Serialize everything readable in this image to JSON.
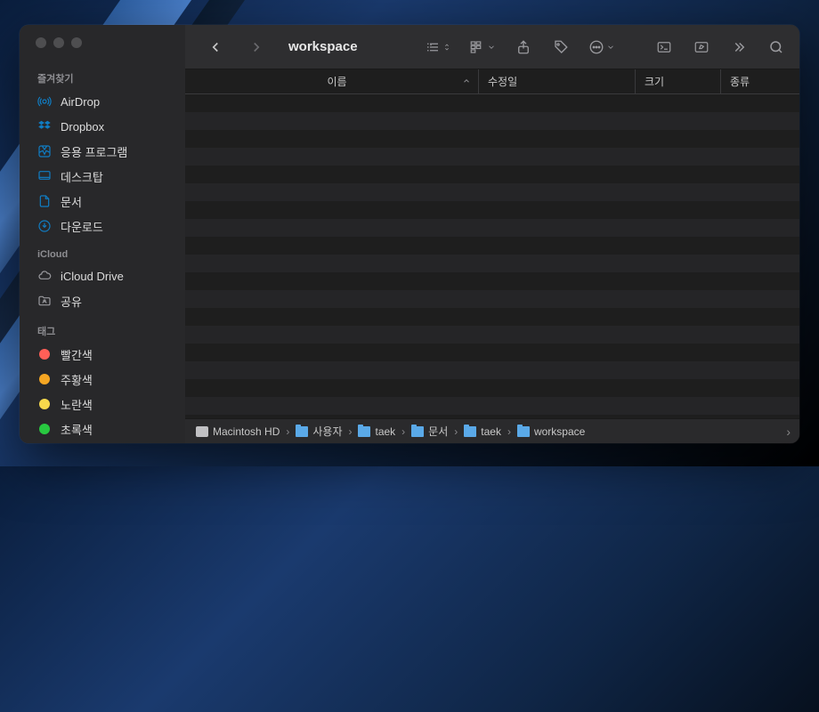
{
  "window_title": "workspace",
  "sidebar": {
    "favorites": {
      "header": "즐겨찾기",
      "items": [
        {
          "label": "AirDrop",
          "icon": "airdrop"
        },
        {
          "label": "Dropbox",
          "icon": "dropbox"
        },
        {
          "label": "응용 프로그램",
          "icon": "apps"
        },
        {
          "label": "데스크탑",
          "icon": "desktop"
        },
        {
          "label": "문서",
          "icon": "document"
        },
        {
          "label": "다운로드",
          "icon": "download"
        }
      ]
    },
    "icloud": {
      "header": "iCloud",
      "items": [
        {
          "label": "iCloud Drive",
          "icon": "cloud"
        },
        {
          "label": "공유",
          "icon": "shared-folder"
        }
      ]
    },
    "tags": {
      "header": "태그",
      "items": [
        {
          "label": "빨간색",
          "color": "#ff5f57"
        },
        {
          "label": "주황색",
          "color": "#f5a623"
        },
        {
          "label": "노란색",
          "color": "#f7d94c"
        },
        {
          "label": "초록색",
          "color": "#28c840"
        }
      ]
    }
  },
  "columns": {
    "name": "이름",
    "date": "수정일",
    "size": "크기",
    "kind": "종류"
  },
  "pathbar": [
    {
      "label": "Macintosh HD",
      "icon": "hd"
    },
    {
      "label": "사용자",
      "icon": "folder"
    },
    {
      "label": "taek",
      "icon": "folder"
    },
    {
      "label": "문서",
      "icon": "folder"
    },
    {
      "label": "taek",
      "icon": "folder"
    },
    {
      "label": "workspace",
      "icon": "folder"
    }
  ],
  "colors": {
    "accent": "#107cc2",
    "tag_red": "#ff5f57",
    "tag_orange": "#f5a623",
    "tag_yellow": "#f7d94c",
    "tag_green": "#28c840"
  }
}
